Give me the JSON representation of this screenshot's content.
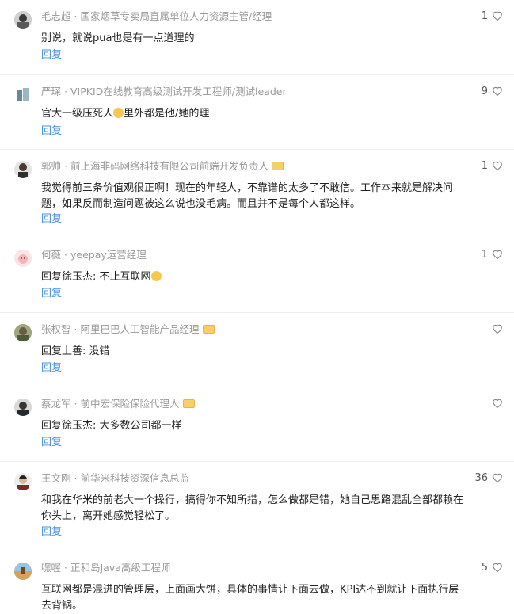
{
  "comments": [
    {
      "author": "毛志超",
      "title": "国家烟草专卖局直属单位人力资源主管/经理",
      "text": "别说，就说pua也是有一点道理的",
      "likes": "1",
      "reply": "回复"
    },
    {
      "author": "严琛",
      "title": "VIPKID在线教育高级测试开发工程师/测试leader",
      "text_a": "官大一级压死人",
      "text_b": "里外都是他/她的理",
      "likes": "9",
      "reply": "回复"
    },
    {
      "author": "郭帅",
      "title": "前上海非码网络科技有限公司前端开发负责人",
      "text": "我觉得前三条价值观很正啊！现在的年轻人，不靠谱的太多了不敢信。工作本来就是解决问题，如果反而制造问题被这么说也没毛病。而且并不是每个人都这样。",
      "likes": "1",
      "reply": "回复"
    },
    {
      "author": "何薇",
      "title": "yeepay运营经理",
      "text": "回复徐玉杰: 不止互联网",
      "likes": "1",
      "reply": "回复"
    },
    {
      "author": "张权智",
      "title": "阿里巴巴人工智能产品经理",
      "text": "回复上善: 没错",
      "likes": "",
      "reply": "回复"
    },
    {
      "author": "蔡龙军",
      "title": "前中宏保险保险代理人",
      "text": "回复徐玉杰: 大多数公司都一样",
      "likes": "",
      "reply": "回复"
    },
    {
      "author": "王文刚",
      "title": "前华米科技资深信息总监",
      "text": "和我在华米的前老大一个操行，搞得你不知所措，怎么做都是错，她自己思路混乱全部都赖在你头上，离开她感觉轻松了。",
      "likes": "36",
      "reply": "回复"
    },
    {
      "author": "嘿喔",
      "title": "正和岛Java高级工程师",
      "text": "互联网都是混进的管理层，上面画大饼，具体的事情让下面去做，KPI达不到就让下面执行层去背锅。",
      "likes": "5",
      "reply": "回复"
    }
  ],
  "colors": {
    "accent": "#4b8fe0",
    "meta": "#999999",
    "text": "#222222"
  }
}
